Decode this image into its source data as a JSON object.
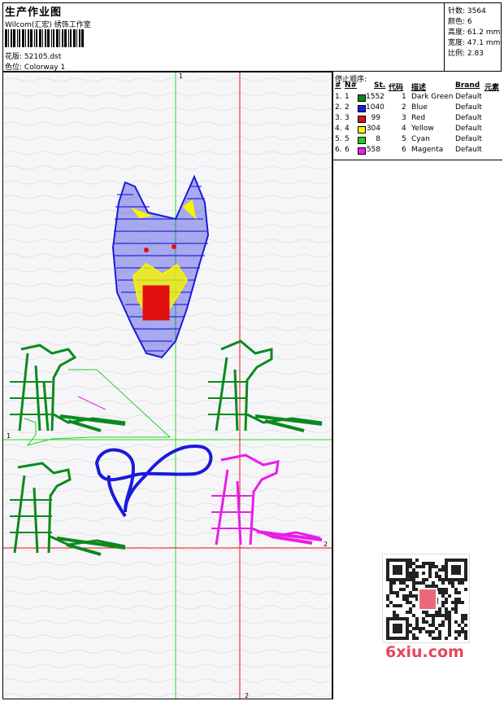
{
  "header": {
    "title": "生产作业图",
    "company": "Wilcom(汇宏) 绣饰工作室",
    "design_file_label": "花版:",
    "design_file": "52105.dst",
    "colorway_label": "色位:",
    "colorway": "Colorway 1"
  },
  "stats": {
    "stitches_label": "针数:",
    "stitches": "3564",
    "colors_label": "颜色:",
    "colors": "6",
    "height_label": "高度:",
    "height": "61.2 mm",
    "width_label": "宽度:",
    "width": "47.1 mm",
    "scale_label": "比例:",
    "scale": "2.83"
  },
  "stop_sequence": {
    "title": "停止顺序:",
    "columns": [
      "#",
      "N#",
      "St.",
      "代码",
      "描述",
      "Brand",
      "元素"
    ],
    "rows": [
      {
        "num": "1.",
        "n": "1",
        "color": "#0a8a1e",
        "st": "1552",
        "code": "1",
        "desc": "Dark Green",
        "brand": "Default"
      },
      {
        "num": "2.",
        "n": "2",
        "color": "#1a1adc",
        "st": "1040",
        "code": "2",
        "desc": "Blue",
        "brand": "Default"
      },
      {
        "num": "3.",
        "n": "3",
        "color": "#e01010",
        "st": "99",
        "code": "3",
        "desc": "Red",
        "brand": "Default"
      },
      {
        "num": "4.",
        "n": "4",
        "color": "#f5f500",
        "st": "304",
        "code": "4",
        "desc": "Yellow",
        "brand": "Default"
      },
      {
        "num": "5.",
        "n": "5",
        "color": "#22cc22",
        "st": "8",
        "code": "5",
        "desc": "Cyan",
        "brand": "Default"
      },
      {
        "num": "6.",
        "n": "6",
        "color": "#e81ee8",
        "st": "558",
        "code": "6",
        "desc": "Magenta",
        "brand": "Default"
      }
    ]
  },
  "canvas": {
    "marker_top": "1",
    "marker_bottom": "2",
    "marker_left": "1",
    "marker_right": "2",
    "green_line_color": "#22dd22",
    "red_line_color": "#ee1111"
  },
  "watermark": {
    "site": "6xiu.com",
    "qr_icon": "qr-code-icon"
  }
}
